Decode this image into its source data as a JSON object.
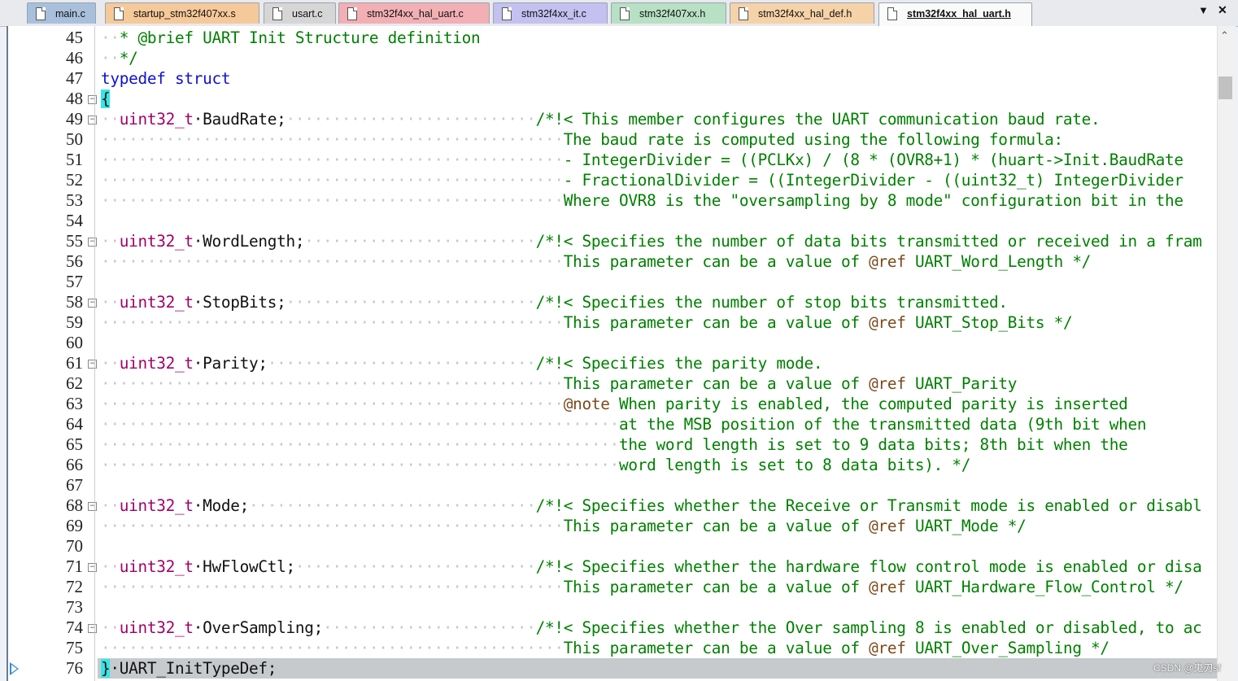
{
  "tabs": [
    {
      "label": "main.c",
      "color": "#a8c0dc"
    },
    {
      "label": "startup_stm32f407xx.s",
      "color": "#f6c99a"
    },
    {
      "label": "usart.c",
      "color": "#d6d6d6"
    },
    {
      "label": "stm32f4xx_hal_uart.c",
      "color": "#f2b0b4"
    },
    {
      "label": "stm32f4xx_it.c",
      "color": "#c4c0f0"
    },
    {
      "label": "stm32f407xx.h",
      "color": "#b8e0c4"
    },
    {
      "label": "stm32f4xx_hal_def.h",
      "color": "#f6d2a8"
    },
    {
      "label": "stm32f4xx_hal_uart.h",
      "color": "#fafafa",
      "active": true
    }
  ],
  "tab_controls": {
    "dropdown": "▼",
    "close": "✕"
  },
  "watermark": "CSDN @鬼刃sf",
  "lines": [
    {
      "n": 45,
      "fold": "",
      "segs": [
        [
          "dot",
          "··"
        ],
        [
          "cm",
          "* @brief UART Init Structure definition"
        ]
      ]
    },
    {
      "n": 46,
      "fold": "",
      "segs": [
        [
          "dot",
          "··"
        ],
        [
          "cm",
          "*/"
        ]
      ]
    },
    {
      "n": 47,
      "fold": "",
      "segs": [
        [
          "kw",
          "typedef struct"
        ]
      ]
    },
    {
      "n": 48,
      "fold": "⊟",
      "segs": [
        [
          "brace",
          "{"
        ]
      ]
    },
    {
      "n": 49,
      "fold": "⊟",
      "segs": [
        [
          "dot",
          "··"
        ],
        [
          "type",
          "uint32_t"
        ],
        [
          "",
          "·BaudRate;"
        ],
        [
          "dot",
          "···························"
        ],
        [
          "cm",
          "/*!< This member configures the UART communication baud rate."
        ]
      ]
    },
    {
      "n": 50,
      "fold": "",
      "segs": [
        [
          "dot",
          "··················································"
        ],
        [
          "cm",
          "The baud rate is computed using the following formula:"
        ]
      ]
    },
    {
      "n": 51,
      "fold": "",
      "segs": [
        [
          "dot",
          "··················································"
        ],
        [
          "cm",
          "- IntegerDivider = ((PCLKx) / (8 * (OVR8+1) * (huart->Init.BaudRate"
        ]
      ]
    },
    {
      "n": 52,
      "fold": "",
      "segs": [
        [
          "dot",
          "··················································"
        ],
        [
          "cm",
          "- FractionalDivider = ((IntegerDivider - ((uint32_t) IntegerDivider"
        ]
      ]
    },
    {
      "n": 53,
      "fold": "",
      "segs": [
        [
          "dot",
          "··················································"
        ],
        [
          "cm",
          "Where OVR8 is the \"oversampling by 8 mode\" configuration bit in the"
        ]
      ]
    },
    {
      "n": 54,
      "fold": "",
      "segs": []
    },
    {
      "n": 55,
      "fold": "⊟",
      "segs": [
        [
          "dot",
          "··"
        ],
        [
          "type",
          "uint32_t"
        ],
        [
          "",
          "·WordLength;"
        ],
        [
          "dot",
          "·························"
        ],
        [
          "cm",
          "/*!< Specifies the number of data bits transmitted or received in a fram"
        ]
      ]
    },
    {
      "n": 56,
      "fold": "",
      "segs": [
        [
          "dot",
          "··················································"
        ],
        [
          "cm",
          "This parameter can be a value of "
        ],
        [
          "tag",
          "@ref"
        ],
        [
          "cm",
          " UART_Word_Length */"
        ]
      ]
    },
    {
      "n": 57,
      "fold": "",
      "segs": []
    },
    {
      "n": 58,
      "fold": "⊟",
      "segs": [
        [
          "dot",
          "··"
        ],
        [
          "type",
          "uint32_t"
        ],
        [
          "",
          "·StopBits;"
        ],
        [
          "dot",
          "···························"
        ],
        [
          "cm",
          "/*!< Specifies the number of stop bits transmitted."
        ]
      ]
    },
    {
      "n": 59,
      "fold": "",
      "segs": [
        [
          "dot",
          "··················································"
        ],
        [
          "cm",
          "This parameter can be a value of "
        ],
        [
          "tag",
          "@ref"
        ],
        [
          "cm",
          " UART_Stop_Bits */"
        ]
      ]
    },
    {
      "n": 60,
      "fold": "",
      "segs": []
    },
    {
      "n": 61,
      "fold": "⊟",
      "segs": [
        [
          "dot",
          "··"
        ],
        [
          "type",
          "uint32_t"
        ],
        [
          "",
          "·Parity;"
        ],
        [
          "dot",
          "·····························"
        ],
        [
          "cm",
          "/*!< Specifies the parity mode."
        ]
      ]
    },
    {
      "n": 62,
      "fold": "",
      "segs": [
        [
          "dot",
          "··················································"
        ],
        [
          "cm",
          "This parameter can be a value of "
        ],
        [
          "tag",
          "@ref"
        ],
        [
          "cm",
          " UART_Parity"
        ]
      ]
    },
    {
      "n": 63,
      "fold": "",
      "segs": [
        [
          "dot",
          "··················································"
        ],
        [
          "tag",
          "@note"
        ],
        [
          "cm",
          " When parity is enabled, the computed parity is inserted"
        ]
      ]
    },
    {
      "n": 64,
      "fold": "",
      "segs": [
        [
          "dot",
          "························································"
        ],
        [
          "cm",
          "at the MSB position of the transmitted data (9th bit when"
        ]
      ]
    },
    {
      "n": 65,
      "fold": "",
      "segs": [
        [
          "dot",
          "························································"
        ],
        [
          "cm",
          "the word length is set to 9 data bits; 8th bit when the"
        ]
      ]
    },
    {
      "n": 66,
      "fold": "",
      "segs": [
        [
          "dot",
          "························································"
        ],
        [
          "cm",
          "word length is set to 8 data bits). */"
        ]
      ]
    },
    {
      "n": 67,
      "fold": "",
      "segs": []
    },
    {
      "n": 68,
      "fold": "⊟",
      "segs": [
        [
          "dot",
          "··"
        ],
        [
          "type",
          "uint32_t"
        ],
        [
          "",
          "·Mode;"
        ],
        [
          "dot",
          "·······························"
        ],
        [
          "cm",
          "/*!< Specifies whether the Receive or Transmit mode is enabled or disabl"
        ]
      ]
    },
    {
      "n": 69,
      "fold": "",
      "segs": [
        [
          "dot",
          "··················································"
        ],
        [
          "cm",
          "This parameter can be a value of "
        ],
        [
          "tag",
          "@ref"
        ],
        [
          "cm",
          " UART_Mode */"
        ]
      ]
    },
    {
      "n": 70,
      "fold": "",
      "segs": []
    },
    {
      "n": 71,
      "fold": "⊟",
      "segs": [
        [
          "dot",
          "··"
        ],
        [
          "type",
          "uint32_t"
        ],
        [
          "",
          "·HwFlowCtl;"
        ],
        [
          "dot",
          "··························"
        ],
        [
          "cm",
          "/*!< Specifies whether the hardware flow control mode is enabled or disa"
        ]
      ]
    },
    {
      "n": 72,
      "fold": "",
      "segs": [
        [
          "dot",
          "··················································"
        ],
        [
          "cm",
          "This parameter can be a value of "
        ],
        [
          "tag",
          "@ref"
        ],
        [
          "cm",
          " UART_Hardware_Flow_Control */"
        ]
      ]
    },
    {
      "n": 73,
      "fold": "",
      "segs": []
    },
    {
      "n": 74,
      "fold": "⊟",
      "segs": [
        [
          "dot",
          "··"
        ],
        [
          "type",
          "uint32_t"
        ],
        [
          "",
          "·OverSampling;"
        ],
        [
          "dot",
          "·······················"
        ],
        [
          "cm",
          "/*!< Specifies whether the Over sampling 8 is enabled or disabled, to ac"
        ]
      ]
    },
    {
      "n": 75,
      "fold": "",
      "segs": [
        [
          "dot",
          "··················································"
        ],
        [
          "cm",
          "This parameter can be a value of "
        ],
        [
          "tag",
          "@ref"
        ],
        [
          "cm",
          " UART_Over_Sampling */"
        ]
      ]
    },
    {
      "n": 76,
      "fold": "",
      "current": true,
      "segs": [
        [
          "brace",
          "}"
        ],
        [
          "",
          "·UART_InitTypeDef;"
        ]
      ]
    }
  ]
}
